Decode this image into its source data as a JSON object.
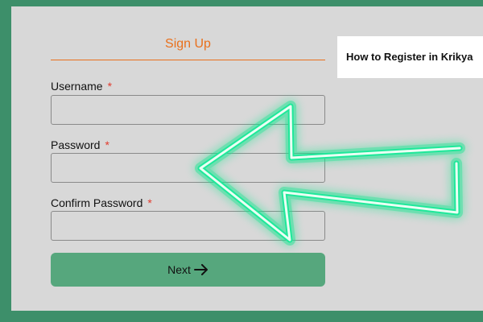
{
  "form": {
    "title": "Sign Up",
    "username_label": "Username",
    "password_label": "Password",
    "confirm_password_label": "Confirm Password",
    "required_marker": "*",
    "username_value": "",
    "password_value": "",
    "confirm_password_value": "",
    "next_label": "Next"
  },
  "side_card": {
    "title": "How to Register in Krikya"
  },
  "colors": {
    "accent_orange": "#e9701c",
    "button_green": "#56a77d",
    "frame_green": "#3d8f6a",
    "glow_arrow": "#19e690"
  },
  "icons": {
    "next_icon": "arrow-right-icon",
    "pointer_overlay": "glowing-arrow-left-icon"
  }
}
